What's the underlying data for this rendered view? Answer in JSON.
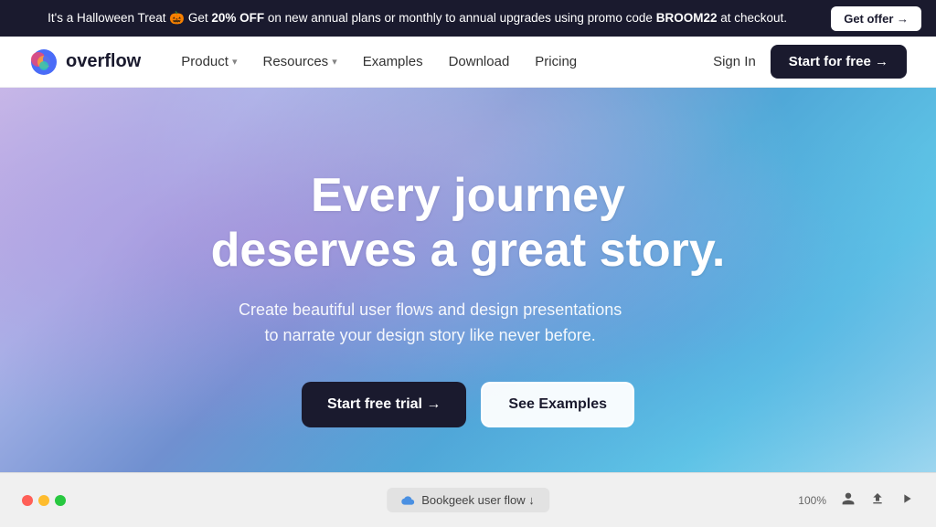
{
  "banner": {
    "text_prefix": "It's a Halloween Treat 🎃 Get ",
    "discount": "20% OFF",
    "text_suffix": " on new annual plans or monthly to annual upgrades using promo code ",
    "promo_code": "BROOM22",
    "text_end": " at checkout.",
    "get_offer_label": "Get offer →",
    "close_label": "×"
  },
  "nav": {
    "logo_text": "overflow",
    "links": [
      {
        "label": "Product",
        "has_dropdown": true
      },
      {
        "label": "Resources",
        "has_dropdown": true
      },
      {
        "label": "Examples",
        "has_dropdown": false
      },
      {
        "label": "Download",
        "has_dropdown": false
      },
      {
        "label": "Pricing",
        "has_dropdown": false
      }
    ],
    "sign_in_label": "Sign In",
    "start_free_label": "Start for free →"
  },
  "hero": {
    "headline_line1": "Every journey",
    "headline_line2": "deserves a great story.",
    "subtext_line1": "Create beautiful user flows and design presentations",
    "subtext_line2": "to narrate your design story like never before.",
    "cta_primary": "Start free trial →",
    "cta_secondary": "See Examples"
  },
  "browser_bar": {
    "tab_title": "Bookgeek user flow ↓",
    "zoom": "100%",
    "icon_person": "👤",
    "icon_upload": "⬆",
    "icon_play": "▶"
  }
}
